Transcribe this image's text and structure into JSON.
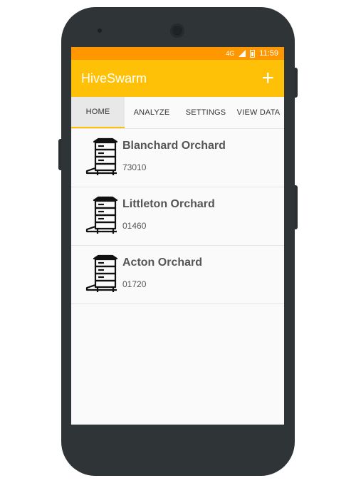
{
  "status_bar": {
    "network": "4G",
    "time": "11:59"
  },
  "app_bar": {
    "title": "HiveSwarm",
    "add_icon": "plus-icon"
  },
  "tabs": [
    {
      "label": "HOME",
      "active": true
    },
    {
      "label": "ANALYZE",
      "active": false
    },
    {
      "label": "SETTINGS",
      "active": false
    },
    {
      "label": "VIEW DATA",
      "active": false
    }
  ],
  "hives": [
    {
      "name": "Blanchard Orchard",
      "zip": "73010",
      "icon": "beehive-icon"
    },
    {
      "name": "Littleton Orchard",
      "zip": "01460",
      "icon": "beehive-icon"
    },
    {
      "name": "Acton Orchard",
      "zip": "01720",
      "icon": "beehive-icon"
    }
  ],
  "colors": {
    "status_bar": "#ff9800",
    "app_bar": "#ffc107",
    "phone_body": "#2f3537"
  }
}
